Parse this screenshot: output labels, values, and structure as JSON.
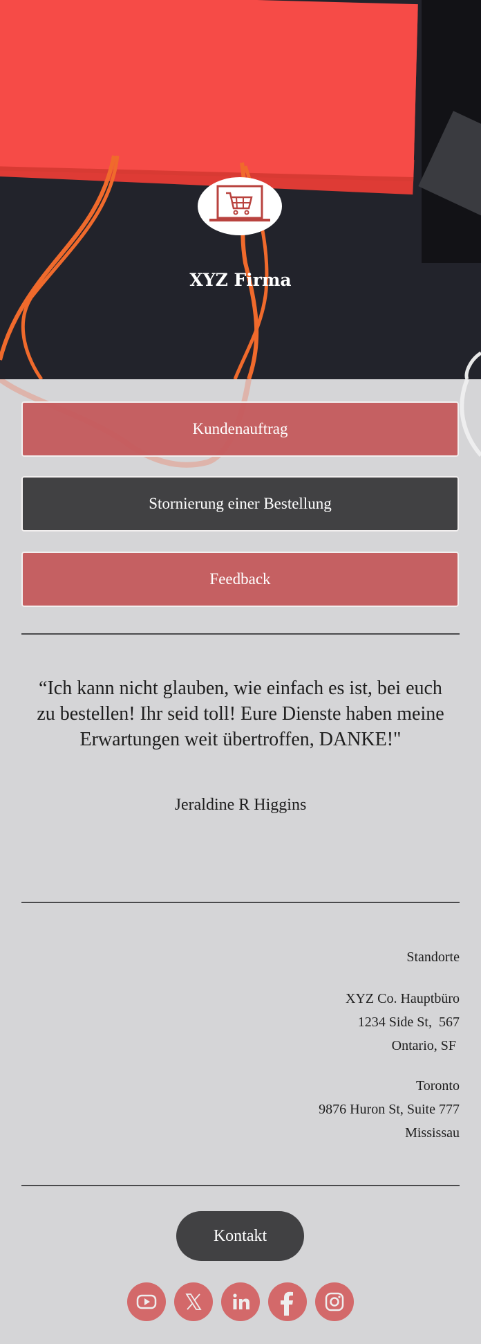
{
  "header": {
    "logo_icon": "laptop-shopping-cart-icon",
    "company_name": "XYZ Firma"
  },
  "actions": [
    {
      "label": "Kundenauftrag",
      "style": "accent"
    },
    {
      "label": "Stornierung einer Bestellung",
      "style": "dark"
    },
    {
      "label": "Feedback",
      "style": "accent"
    }
  ],
  "testimonial": {
    "quote": "“Ich kann nicht glauben, wie einfach es ist, bei euch zu bestellen! Ihr seid toll! Eure Dienste haben meine Erwartungen weit übertroffen, DANKE!\"",
    "author": "Jeraldine R Higgins"
  },
  "locations": {
    "heading": "Standorte",
    "offices": [
      {
        "lines": [
          "XYZ Co. Hauptbüro",
          "1234 Side St,  567",
          "Ontario, SF "
        ]
      },
      {
        "lines": [
          "Toronto",
          "9876 Huron St, Suite 777",
          "Mississau"
        ]
      }
    ]
  },
  "footer": {
    "contact_label": "Kontakt",
    "socials": [
      {
        "name": "youtube",
        "icon": "youtube-icon"
      },
      {
        "name": "x",
        "icon": "x-icon"
      },
      {
        "name": "linkedin",
        "icon": "linkedin-icon"
      },
      {
        "name": "facebook",
        "icon": "facebook-icon"
      },
      {
        "name": "instagram",
        "icon": "instagram-icon"
      }
    ]
  },
  "colors": {
    "accent": "#c45a5c",
    "dark": "#414143",
    "social": "#d3696a",
    "background": "#d5d5d7",
    "logo_red": "#b9433f"
  }
}
